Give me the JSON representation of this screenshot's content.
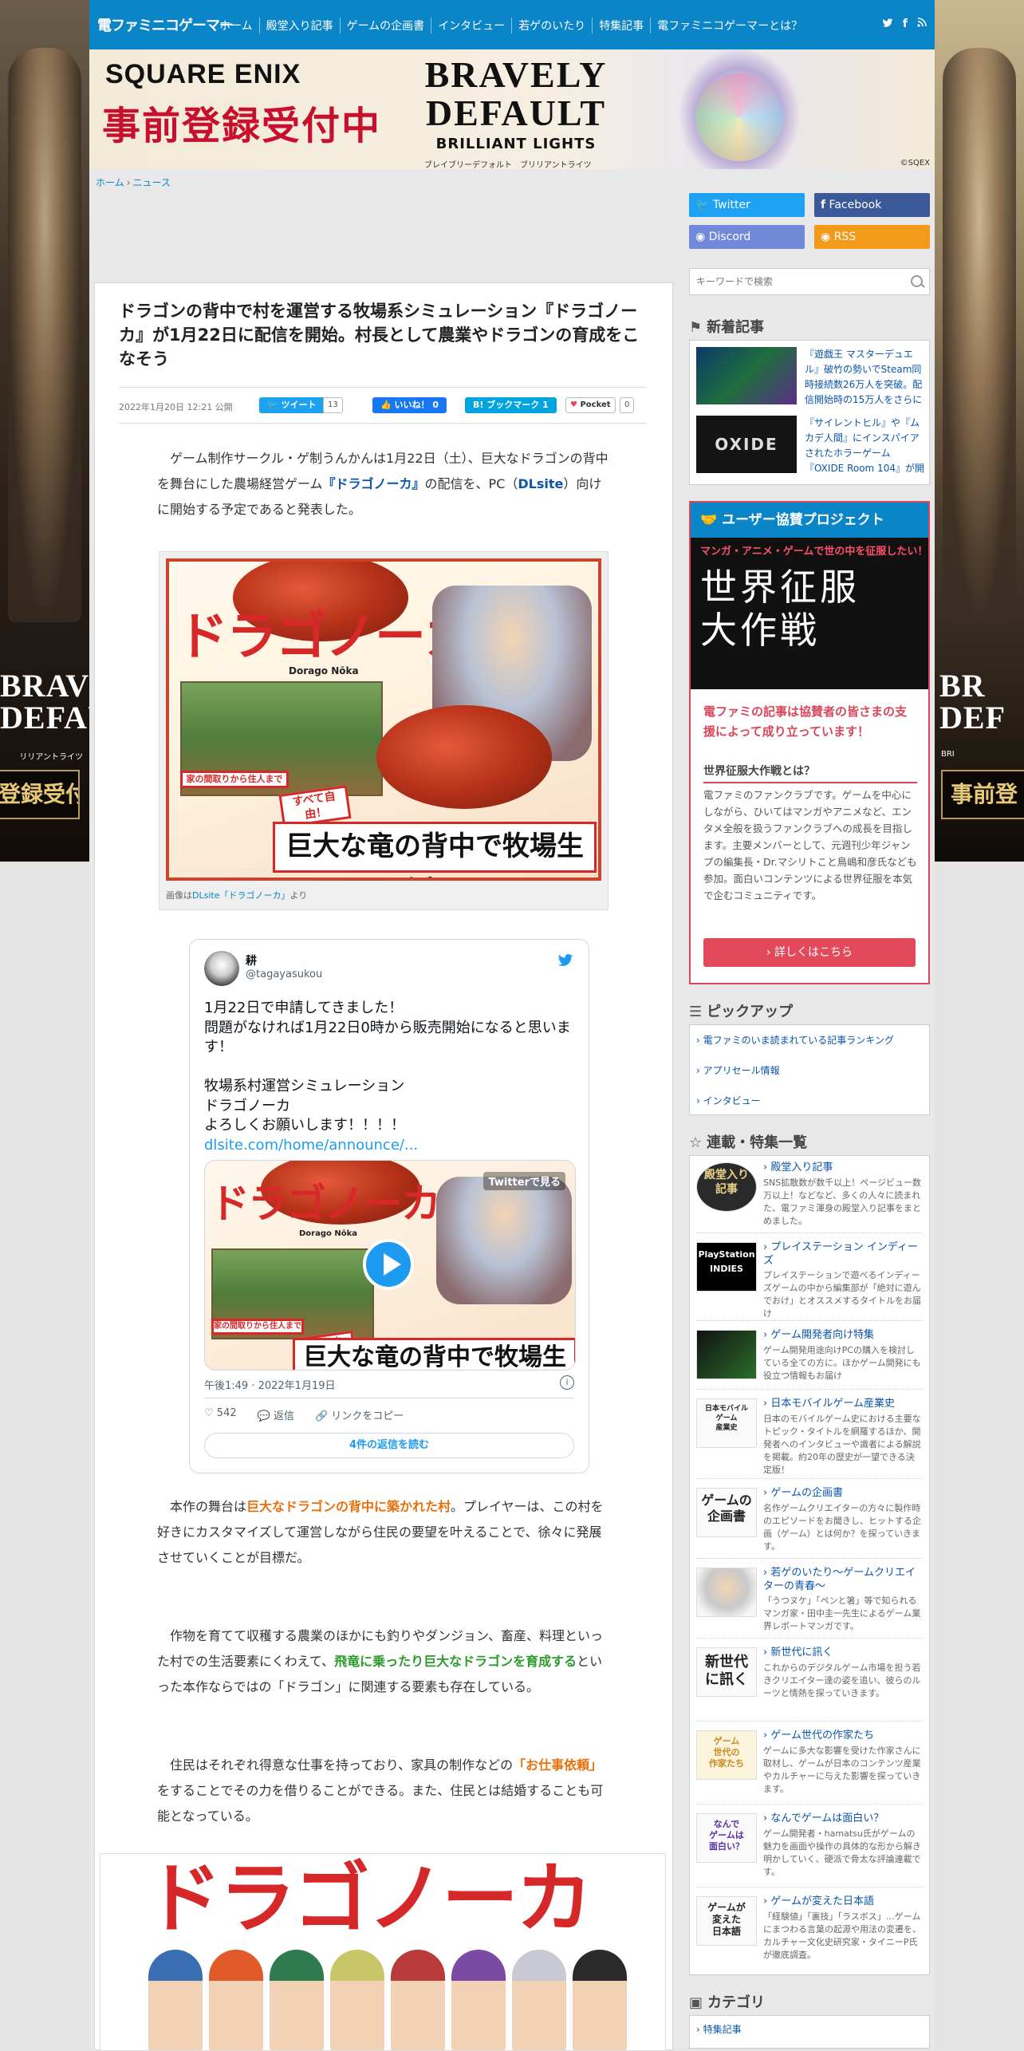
{
  "header": {
    "logo": "電ファミニコゲーマー",
    "nav": [
      "ホーム",
      "殿堂入り記事",
      "ゲームの企画書",
      "インタビュー",
      "若ゲのいたり",
      "特集記事",
      "電ファミニコゲーマーとは？"
    ],
    "social": [
      "twitter-icon",
      "facebook-icon",
      "rss-icon"
    ]
  },
  "side_banner": {
    "left_title": "BRAVELY\nDEFAULT",
    "left_kana": "リリアントライツ",
    "left_cta": "事前登録受付中！",
    "right_title": "BR\nDEF",
    "right_kana": "BRI",
    "right_cta": "事前登"
  },
  "top_banner": {
    "brand": "SQUARE ENIX",
    "preorder": "事前登録受付中",
    "title_line1": "BRAVELY",
    "title_line2": "DEFAULT",
    "subtitle": "BRILLIANT LIGHTS",
    "kana": "ブレイブリーデフォルト　ブリリアントライツ",
    "copyright": "©SQEX"
  },
  "breadcrumb": {
    "home": "ホーム",
    "sep": "›",
    "current": "ニュース"
  },
  "article": {
    "title": "ドラゴンの背中で村を運営する牧場系シミュレーション『ドラゴノーカ』が1月22日に配信を開始。村長として農業やドラゴンの育成をこなそう",
    "date": "2022年1月20日 12:21 公開",
    "share": {
      "tweet": "ツイート",
      "tweet_count": "13",
      "like": "いいね！ 0",
      "hatena": "B! ブックマーク",
      "hatena_count": "1",
      "pocket": "Pocket",
      "pocket_count": "0"
    },
    "p1_a": "ゲーム制作サークル・ゲ制うんかんは1月22日（土）、巨大なドラゴンの背中を舞台にした農場経営ゲーム",
    "p1_b": "『ドラゴノーカ』",
    "p1_c": "の配信を、PC（",
    "p1_d": "DLsite",
    "p1_e": "）向けに開始する予定であると発表した。",
    "fig1_caption_a": "画像は",
    "fig1_caption_link": "DLsite「ドラゴノーカ」",
    "fig1_caption_b": "より",
    "p2_a": "本作の舞台は",
    "p2_b": "巨大なドラゴンの背中に築かれた村",
    "p2_c": "。プレイヤーは、この村を好きにカスタマイズして運営しながら住民の要望を叶えることで、徐々に発展させていくことが目標だ。",
    "p3_a": "作物を育てて収穫する農業のほかにも釣りやダンジョン、畜産、料理といった村での生活要素にくわえて、",
    "p3_b": "飛竜に乗ったり巨大なドラゴンを育成する",
    "p3_c": "といった本作ならではの「ドラゴン」に関連する要素も存在している。",
    "p4_a": "住民はそれぞれ得意な仕事を持っており、家具の制作などの",
    "p4_b": "「お仕事依頼」",
    "p4_c": "をすることでその力を借りることができる。また、住民とは結婚することも可能となっている。"
  },
  "game_image": {
    "logo": "ドラゴノーカ",
    "romaji": "Dorago Nōka",
    "tag1": "家の間取りから住人まで",
    "tag2": "すべて自由！",
    "catch": "巨大な竜の背中で牧場生活！"
  },
  "tweet": {
    "name": "耕",
    "handle": "@tagayasukou",
    "text": "1月22日で申請してきました！\n問題がなければ1月22日0時から販売開始になると思います！\n\n牧場系村運営シミュレーション\nドラゴノーカ\nよろしくお願いします！！！！",
    "link": "dlsite.com/home/announce/...",
    "watch": "Twitterで見る",
    "time": "午後1:49 · 2022年1月19日",
    "likes": "542",
    "reply": "返信",
    "copy_link": "リンクをコピー",
    "read_replies": "4件の返信を読む"
  },
  "sidebar": {
    "sns": {
      "twitter": "Twitter",
      "facebook": "Facebook",
      "discord": "Discord",
      "rss": "RSS"
    },
    "search_placeholder": "キーワードで検索",
    "news_title": "新着記事",
    "news": [
      {
        "text": "『遊戯王 マスターデュエル』破竹の勢いでSteam同時接続数26万人を突破。配信開始時の15万人をさらに"
      },
      {
        "text": "『サイレントヒル』や『ムカデ人間』にインスパイアされたホラーゲーム『OXIDE Room 104』が開",
        "thumb_label": "OXIDE"
      }
    ],
    "project": {
      "title": "ユーザー協賛プロジェクト",
      "img_top": "マンガ・アニメ・ゲームで世の中を征服したい！",
      "img_cal": "世界征服\n大作戦",
      "lead": "電ファミの記事は協賛者の皆さまの支援によって成り立っています！",
      "sub": "世界征服大作戦とは？",
      "desc": "電ファミのファンクラブです。ゲームを中心にしながら、ひいてはマンガやアニメなど、エンタメ全般を扱うファンクラブへの成長を目指します。主要メンバーとして、元週刊少年ジャンプの編集長・Dr.マシリトこと鳥嶋和彦氏なども参加。面白いコンテンツによる世界征服を本気で企むコミュニティです。",
      "button": "詳しくはこちら"
    },
    "pickup_title": "ピックアップ",
    "pickup": [
      "電ファミのいま読まれている記事ランキング",
      "アプリセール情報",
      "インタビュー"
    ],
    "series_title": "連載・特集一覧",
    "series": [
      {
        "thumb": "殿堂入り\n記事",
        "title": "殿堂入り記事",
        "desc": "SNS拡散数が数千以上！ページビュー数万以上！などなど、多くの人々に読まれた、電ファミ渾身の殿堂入り記事をまとめました。"
      },
      {
        "thumb": "PlayStation\nINDIES",
        "title": "プレイステーション インディーズ",
        "desc": "プレイステーションで遊べるインディーズゲームの中から編集部が「絶対に遊んでおけ」とオススメするタイトルをお届け"
      },
      {
        "thumb": "",
        "title": "ゲーム開発者向け特集",
        "desc": "ゲーム開発用途向けPCの購入を検討している全ての方に。ほかゲーム開発にも役立つ情報もお届け"
      },
      {
        "thumb": "日本モバイル\nゲーム\n産業史",
        "title": "日本モバイルゲーム産業史",
        "desc": "日本のモバイルゲーム史における主要なトピック・タイトルを網羅するほか、開発者へのインタビューや識者による解説を掲載。約20年の歴史が一望できる決定版！"
      },
      {
        "thumb": "ゲームの\n企画書",
        "title": "ゲームの企画書",
        "desc": "名作ゲームクリエイターの方々に製作時のエピソードをお聞きし、ヒットする企画（ゲーム）とは何か？を探っていきます。"
      },
      {
        "thumb": "",
        "title": "若ゲのいたり～ゲームクリエイターの青春～",
        "desc": "「うつヌケ」「ペンと箸」等で知られるマンガ家・田中圭一先生によるゲーム業界レポートマンガです。"
      },
      {
        "thumb": "新世代\nに訊く",
        "title": "新世代に訊く",
        "desc": "これからのデジタルゲーム市場を担う若きクリエイター達の姿を追い、彼らのルーツと情熱を探っていきます。"
      },
      {
        "thumb": "ゲーム\n世代の\n作家たち",
        "title": "ゲーム世代の作家たち",
        "desc": "ゲームに多大な影響を受けた作家さんに取材し、ゲームが日本のコンテンツ産業やカルチャーに与えた影響を探っていきます。"
      },
      {
        "thumb": "なんで\nゲームは\n面白い？",
        "title": "なんでゲームは面白い？",
        "desc": "ゲーム開発者・hamatsu氏がゲームの魅力を画面や操作の具体的な形から解き明かしていく、硬派で骨太な評論連載です。"
      },
      {
        "thumb": "ゲームが\n変えた\n日本語",
        "title": "ゲームが変えた日本語",
        "desc": "「経験値」「裏技」「ラスボス」…ゲームにまつわる言葉の起源や用法の変遷を、カルチャー文化史研究家・タイニーP氏が徹底調査。"
      }
    ],
    "category_title": "カテゴリ",
    "categories": [
      "特集記事"
    ]
  },
  "colors": {
    "brand_blue": "#0a85c8",
    "accent_red": "#d9465a",
    "orange": "#e8700c",
    "green": "#2a9a2a"
  }
}
